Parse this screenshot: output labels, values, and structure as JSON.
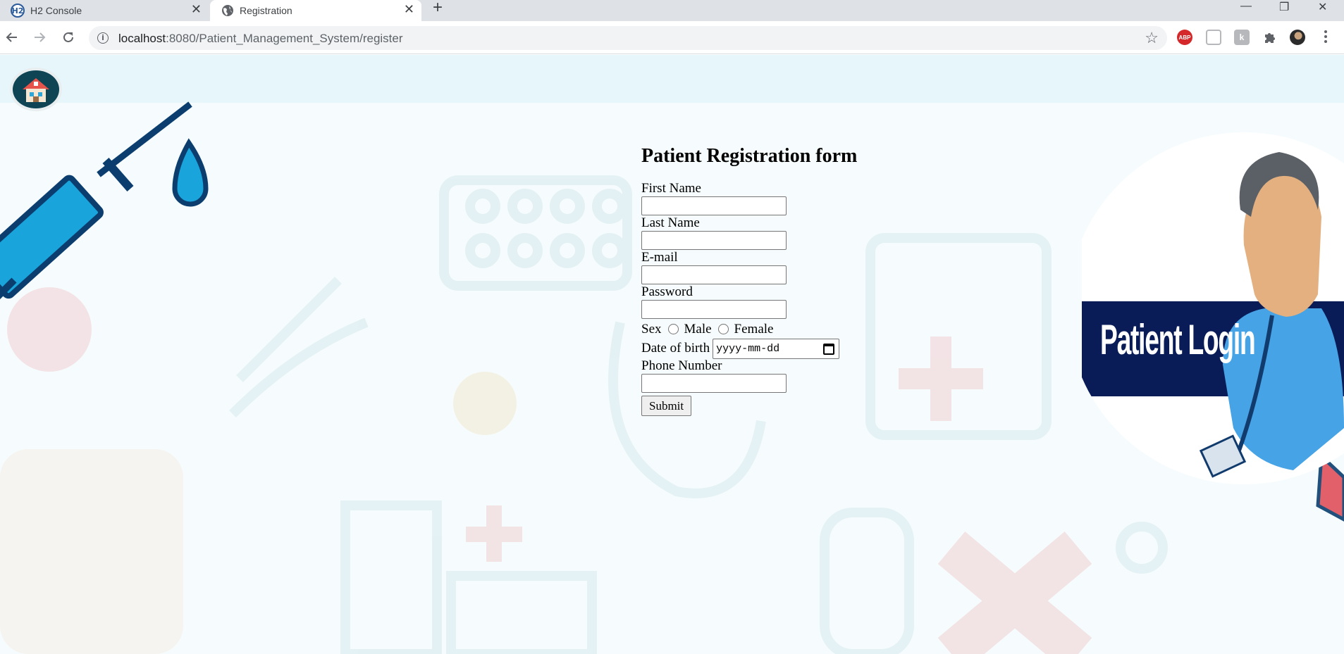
{
  "browser": {
    "tabs": [
      {
        "title": "H2 Console",
        "active": false,
        "icon": "h2-icon"
      },
      {
        "title": "Registration",
        "active": true,
        "icon": "globe-icon"
      }
    ],
    "url_host": "localhost",
    "url_path": ":8080/Patient_Management_System/register",
    "extensions": {
      "abp_label": "ABP",
      "ext2_label": "k"
    }
  },
  "page": {
    "form": {
      "title": "Patient Registration form",
      "first_name_label": "First Name",
      "last_name_label": "Last Name",
      "email_label": "E-mail",
      "password_label": "Password",
      "sex_label": "Sex",
      "male_label": "Male",
      "female_label": "Female",
      "dob_label": "Date of birth",
      "dob_placeholder": "yyyy-mm-dd",
      "phone_label": "Phone Number",
      "submit_label": "Submit"
    },
    "login_banner": {
      "text": "Patient Login"
    },
    "colors": {
      "accent": "#0aa5d8",
      "navy": "#0a1c57",
      "background": "#f6fcfd"
    }
  }
}
